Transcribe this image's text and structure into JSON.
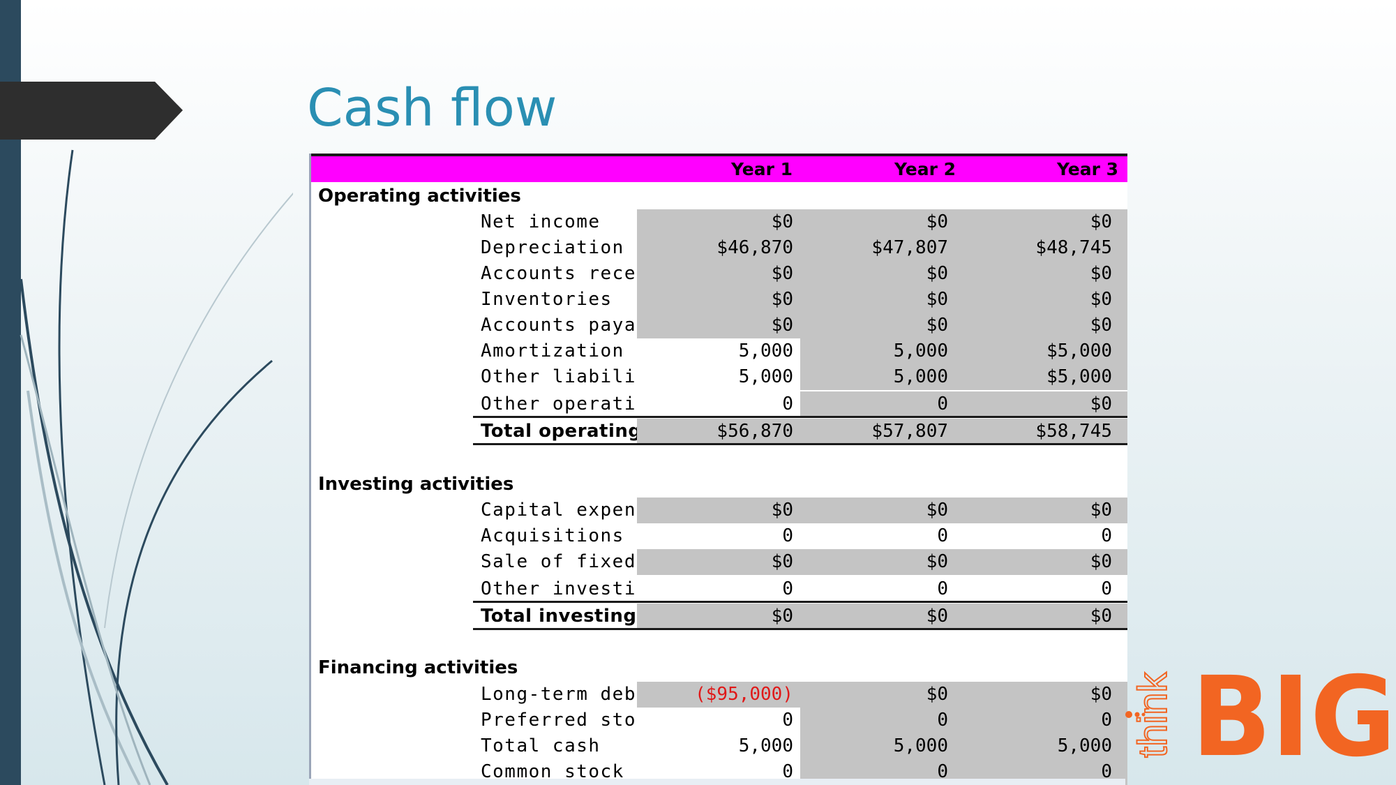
{
  "title": "Cash flow",
  "colors": {
    "accent": "#2a8fb3",
    "header_bg": "#ff00ff",
    "cell_gray": "#c4c4c4",
    "negative": "#e01818",
    "logo_orange": "#f26522"
  },
  "table": {
    "headers": [
      "Year 1",
      "Year 2",
      "Year 3"
    ],
    "operating": {
      "title": "Operating activities",
      "rows": [
        {
          "label": "Net income",
          "values": [
            "$0",
            "$0",
            "$0"
          ]
        },
        {
          "label": "Depreciation",
          "values": [
            "$46,870",
            "$47,807",
            "$48,745"
          ]
        },
        {
          "label": "Accounts receivable",
          "values": [
            "$0",
            "$0",
            "$0"
          ]
        },
        {
          "label": "Inventories",
          "values": [
            "$0",
            "$0",
            "$0"
          ]
        },
        {
          "label": "Accounts payable",
          "values": [
            "$0",
            "$0",
            "$0"
          ]
        },
        {
          "label": "Amortization",
          "values": [
            "5,000",
            "5,000",
            "$5,000"
          ]
        },
        {
          "label": "Other liabilities",
          "values": [
            "5,000",
            "5,000",
            "$5,000"
          ]
        },
        {
          "label": "Other operating",
          "values": [
            "0",
            "0",
            "$0"
          ]
        }
      ],
      "total": {
        "label": "Total operating",
        "values": [
          "$56,870",
          "$57,807",
          "$58,745"
        ]
      }
    },
    "investing": {
      "title": "Investing activities",
      "rows": [
        {
          "label": "Capital expenditures",
          "values": [
            "$0",
            "$0",
            "$0"
          ]
        },
        {
          "label": "Acquisitions",
          "values": [
            "0",
            "0",
            "0"
          ]
        },
        {
          "label": "Sale of fixed assets",
          "values": [
            "$0",
            "$0",
            "$0"
          ]
        },
        {
          "label": "Other investing",
          "values": [
            "0",
            "0",
            "0"
          ]
        }
      ],
      "total": {
        "label": "Total investing",
        "values": [
          "$0",
          "$0",
          "$0"
        ]
      }
    },
    "financing": {
      "title": "Financing activities",
      "rows": [
        {
          "label": "Long-term debt",
          "values": [
            "($95,000)",
            "$0",
            "$0"
          ]
        },
        {
          "label": "Preferred stock",
          "values": [
            "0",
            "0",
            "0"
          ]
        },
        {
          "label": "Total cash",
          "values": [
            "5,000",
            "5,000",
            "5,000"
          ]
        },
        {
          "label": "Common stock",
          "values": [
            "0",
            "0",
            "0"
          ]
        }
      ]
    }
  },
  "logo": {
    "small_text": "think",
    "big_text": "BIG"
  }
}
